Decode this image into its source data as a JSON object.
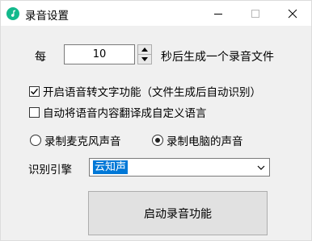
{
  "window": {
    "title": "录音设置"
  },
  "interval": {
    "prefix_label": "每",
    "value": "10",
    "suffix_label": "秒后生成一个录音文件"
  },
  "options": {
    "speech_to_text": {
      "label": "开启语音转文字功能（文件生成后自动识别）",
      "checked": true
    },
    "translate": {
      "label": "自动将语音内容翻译成自定义语言",
      "checked": false
    }
  },
  "source": {
    "microphone": {
      "label": "录制麦克风声音",
      "selected": false
    },
    "computer": {
      "label": "录制电脑的声音",
      "selected": true
    }
  },
  "engine": {
    "label": "识别引擎",
    "value": "云知声"
  },
  "start_button": {
    "label": "启动录音功能"
  },
  "colors": {
    "accent": "#0078d7",
    "icon": "#13b98c"
  }
}
